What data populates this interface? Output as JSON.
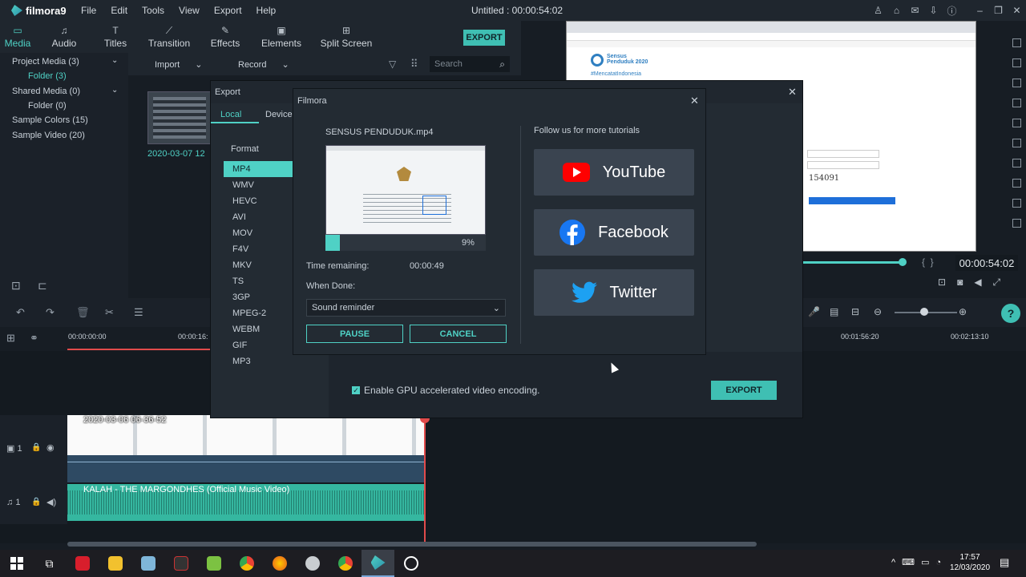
{
  "app": {
    "name": "filmora9",
    "title": "Untitled : 00:00:54:02"
  },
  "menu": [
    "File",
    "Edit",
    "Tools",
    "View",
    "Export",
    "Help"
  ],
  "toolbar": {
    "items": [
      "Media",
      "Audio",
      "Titles",
      "Transition",
      "Effects",
      "Elements",
      "Split Screen"
    ],
    "export_label": "EXPORT"
  },
  "left_panel": {
    "project_media": "Project Media (3)",
    "folder_3": "Folder (3)",
    "shared_media": "Shared Media (0)",
    "folder_0": "Folder (0)",
    "sample_colors": "Sample Colors (15)",
    "sample_video": "Sample Video (20)"
  },
  "media_bar": {
    "import": "Import",
    "record": "Record",
    "search_placeholder": "Search"
  },
  "media_item": {
    "name": "2020-03-07 12"
  },
  "preview": {
    "timecode": "00:00:54:02",
    "site_title": "Sensus Penduduk 2020",
    "hashtag": "#MencatatIndonesia",
    "captcha": "154091"
  },
  "timeline": {
    "ruler": [
      "00:00:00:00",
      "00:00:16:",
      "00:01:56:20",
      "00:02:13:10"
    ],
    "video_clip": "2020-03-06 06-36-52",
    "audio_clip": "KALAH - THE MARGONDHES  (Official Music Video)",
    "video_track_label": "1",
    "audio_track_label": "1"
  },
  "export_dialog": {
    "title": "Export",
    "tabs": [
      "Local",
      "Device"
    ],
    "format_heading": "Format",
    "formats": [
      "MP4",
      "WMV",
      "HEVC",
      "AVI",
      "MOV",
      "F4V",
      "MKV",
      "TS",
      "3GP",
      "MPEG-2",
      "WEBM",
      "GIF",
      "MP3"
    ],
    "selected_format": "MP4",
    "gpu_label": "Enable GPU accelerated video encoding.",
    "gpu_checked": true,
    "export_button": "EXPORT"
  },
  "filmora_dialog": {
    "title": "Filmora",
    "file_name": "SENSUS PENDUDUK.mp4",
    "progress_percent": 9,
    "progress_text": "9%",
    "time_remaining_label": "Time remaining:",
    "time_remaining": "00:00:49",
    "when_done_label": "When Done:",
    "when_done_value": "Sound reminder",
    "pause": "PAUSE",
    "cancel": "CANCEL",
    "follow_text": "Follow us for more tutorials",
    "social": [
      "YouTube",
      "Facebook",
      "Twitter"
    ]
  },
  "taskbar": {
    "time": "17:57",
    "date": "12/03/2020"
  },
  "colors": {
    "accent": "#4fd1c5",
    "youtube": "#ff0000",
    "facebook": "#1877f2",
    "twitter": "#1da1f2"
  }
}
